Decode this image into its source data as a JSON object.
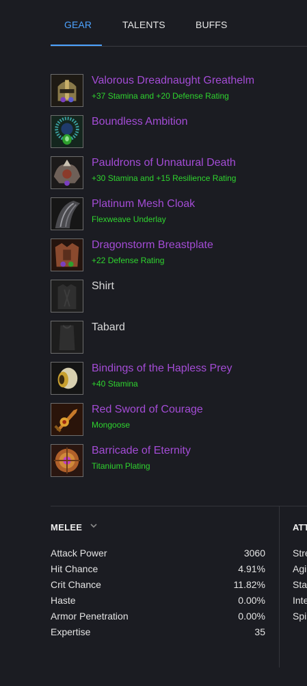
{
  "tabs": [
    {
      "label": "GEAR",
      "active": true
    },
    {
      "label": "TALENTS",
      "active": false
    },
    {
      "label": "BUFFS",
      "active": false
    }
  ],
  "gear": [
    {
      "name": "Valorous Dreadnaught Greathelm",
      "enchant": "+37 Stamina and +20 Defense Rating",
      "quality": "epic",
      "icon": "helm-icon"
    },
    {
      "name": "Boundless Ambition",
      "enchant": "",
      "quality": "epic",
      "icon": "amulet-icon"
    },
    {
      "name": "Pauldrons of Unnatural Death",
      "enchant": "+30 Stamina and +15 Resilience Rating",
      "quality": "epic",
      "icon": "shoulders-icon"
    },
    {
      "name": "Platinum Mesh Cloak",
      "enchant": "Flexweave Underlay",
      "quality": "epic",
      "icon": "cloak-icon"
    },
    {
      "name": "Dragonstorm Breastplate",
      "enchant": "+22 Defense Rating",
      "quality": "epic",
      "icon": "chest-icon"
    },
    {
      "name": "Shirt",
      "enchant": "",
      "quality": "common",
      "icon": "shirt-icon"
    },
    {
      "name": "Tabard",
      "enchant": "",
      "quality": "common",
      "icon": "tabard-icon"
    },
    {
      "name": "Bindings of the Hapless Prey",
      "enchant": "+40 Stamina",
      "quality": "epic",
      "icon": "bracers-icon"
    },
    {
      "name": "Red Sword of Courage",
      "enchant": "Mongoose",
      "quality": "epic",
      "icon": "sword-icon"
    },
    {
      "name": "Barricade of Eternity",
      "enchant": "Titanium Plating",
      "quality": "epic",
      "icon": "shield-icon"
    }
  ],
  "stats": {
    "melee_header": "MELEE",
    "rows": [
      {
        "label": "Attack Power",
        "value": "3060"
      },
      {
        "label": "Hit Chance",
        "value": "4.91%"
      },
      {
        "label": "Crit Chance",
        "value": "11.82%"
      },
      {
        "label": "Haste",
        "value": "0.00%"
      },
      {
        "label": "Armor Penetration",
        "value": "0.00%"
      },
      {
        "label": "Expertise",
        "value": "35"
      }
    ],
    "side_header": "ATT",
    "side_labels": [
      "Stre",
      "Agi",
      "Sta",
      "Inte",
      "Spi"
    ]
  },
  "colors": {
    "accent": "#4da3ff",
    "epic": "#a44cd6",
    "enchant": "#2fd52f",
    "background": "#1b1c22"
  }
}
